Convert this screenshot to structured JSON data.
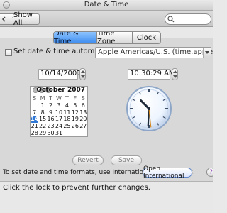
{
  "window": {
    "title": "Date & Time"
  },
  "toolbar": {
    "show_all": "Show All",
    "back_icon": "back-chevron-icon",
    "forward_icon": "forward-chevron-icon",
    "search_icon": "search-icon",
    "search_placeholder": ""
  },
  "tabs": [
    {
      "label": "Date & Time",
      "active": true
    },
    {
      "label": "Time Zone",
      "active": false
    },
    {
      "label": "Clock",
      "active": false
    }
  ],
  "auto": {
    "label": "Set date & time automatically:",
    "server": "Apple Americas/U.S. (time.apple.com)"
  },
  "date": {
    "value": "10/14/2007"
  },
  "time": {
    "value": "10:30:29 AM"
  },
  "calendar": {
    "month_label": "October 2007",
    "weekdays": [
      "S",
      "M",
      "T",
      "W",
      "T",
      "F",
      "S"
    ],
    "days": [
      "",
      "1",
      "2",
      "3",
      "4",
      "5",
      "6",
      "7",
      "8",
      "9",
      "10",
      "11",
      "12",
      "13",
      "14",
      "15",
      "16",
      "17",
      "18",
      "19",
      "20",
      "21",
      "22",
      "23",
      "24",
      "25",
      "26",
      "27",
      "28",
      "29",
      "30",
      "31",
      "",
      "",
      ""
    ],
    "selected_day": "14"
  },
  "clock": {
    "time": "10:30:29"
  },
  "buttons": {
    "revert": "Revert",
    "save": "Save",
    "open_international": "Open International",
    "help": "?"
  },
  "international_text": "To set date and time formats, use International preferences.",
  "lock_text": "Click the lock to prevent further changes."
}
